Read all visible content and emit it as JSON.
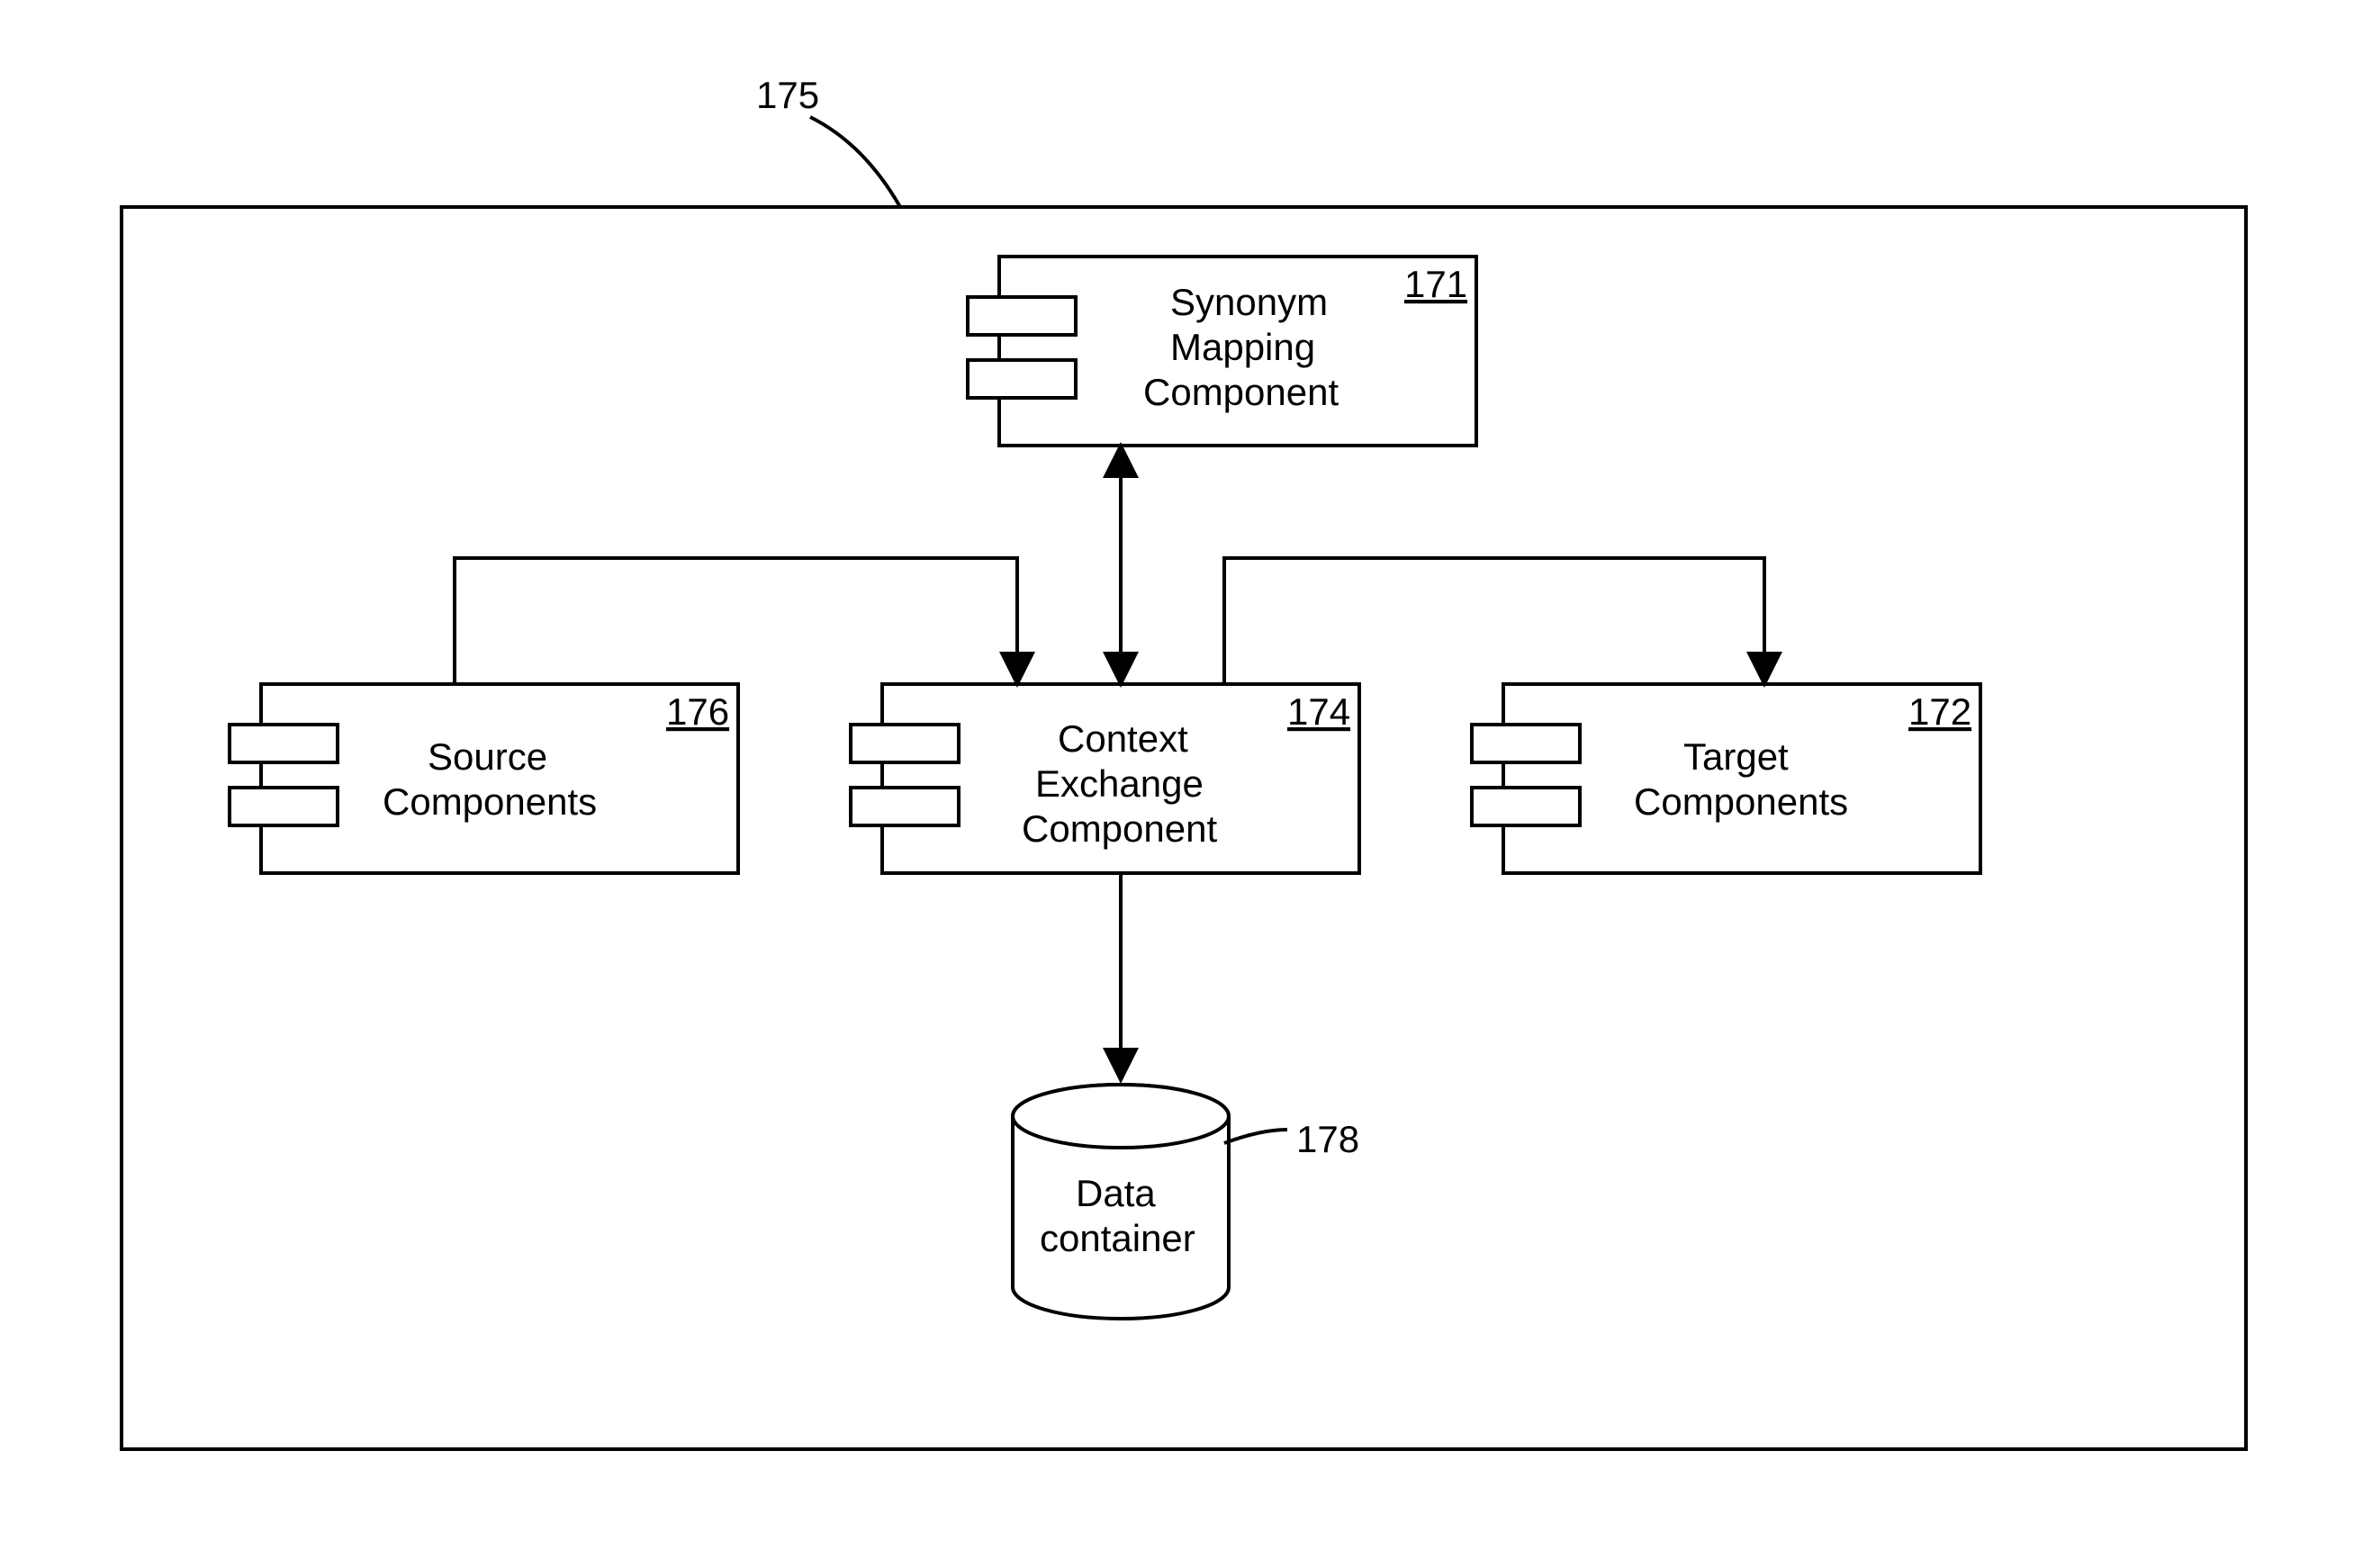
{
  "outer_ref": "175",
  "blocks": {
    "synonym": {
      "ref": "171",
      "line1": "Synonym",
      "line2": "Mapping",
      "line3": "Component"
    },
    "source": {
      "ref": "176",
      "line1": "Source",
      "line2": "Components"
    },
    "context": {
      "ref": "174",
      "line1": "Context",
      "line2": "Exchange",
      "line3": "Component"
    },
    "target": {
      "ref": "172",
      "line1": "Target",
      "line2": "Components"
    },
    "data": {
      "ref": "178",
      "line1": "Data",
      "line2": "container"
    }
  }
}
